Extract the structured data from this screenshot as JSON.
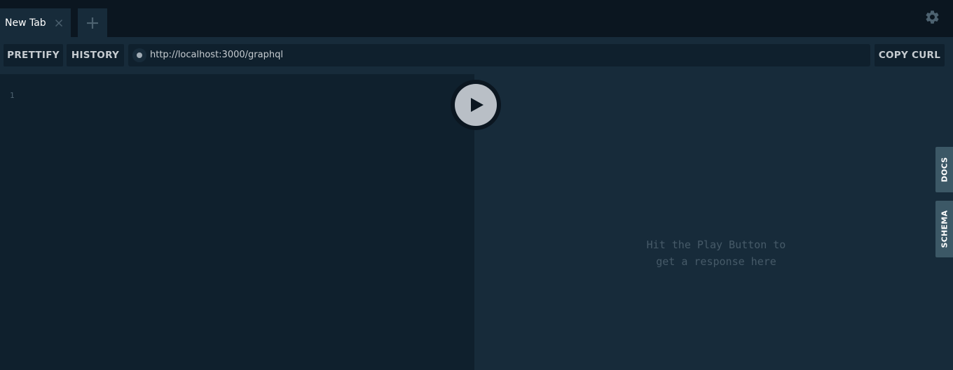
{
  "tabs": [
    {
      "label": "New Tab",
      "close_icon": "close-icon"
    }
  ],
  "add_tab_icon": "plus-icon",
  "settings_icon": "gear-icon",
  "toolbar": {
    "prettify_label": "PRETTIFY",
    "history_label": "HISTORY",
    "url": "http://localhost:3000/graphql",
    "copy_curl_label": "COPY CURL"
  },
  "editor": {
    "line_numbers": [
      "1"
    ]
  },
  "play_button_icon": "play-icon",
  "result": {
    "placeholder_line1": "Hit the Play Button to",
    "placeholder_line2": "get a response here"
  },
  "side_tabs": {
    "docs_label": "DOCS",
    "schema_label": "SCHEMA"
  },
  "colors": {
    "background": "#172b3a",
    "tabbar": "#0b1620",
    "editor": "#0f202d",
    "side_tab": "#3c5866",
    "play_button": "#b9bfc6"
  }
}
